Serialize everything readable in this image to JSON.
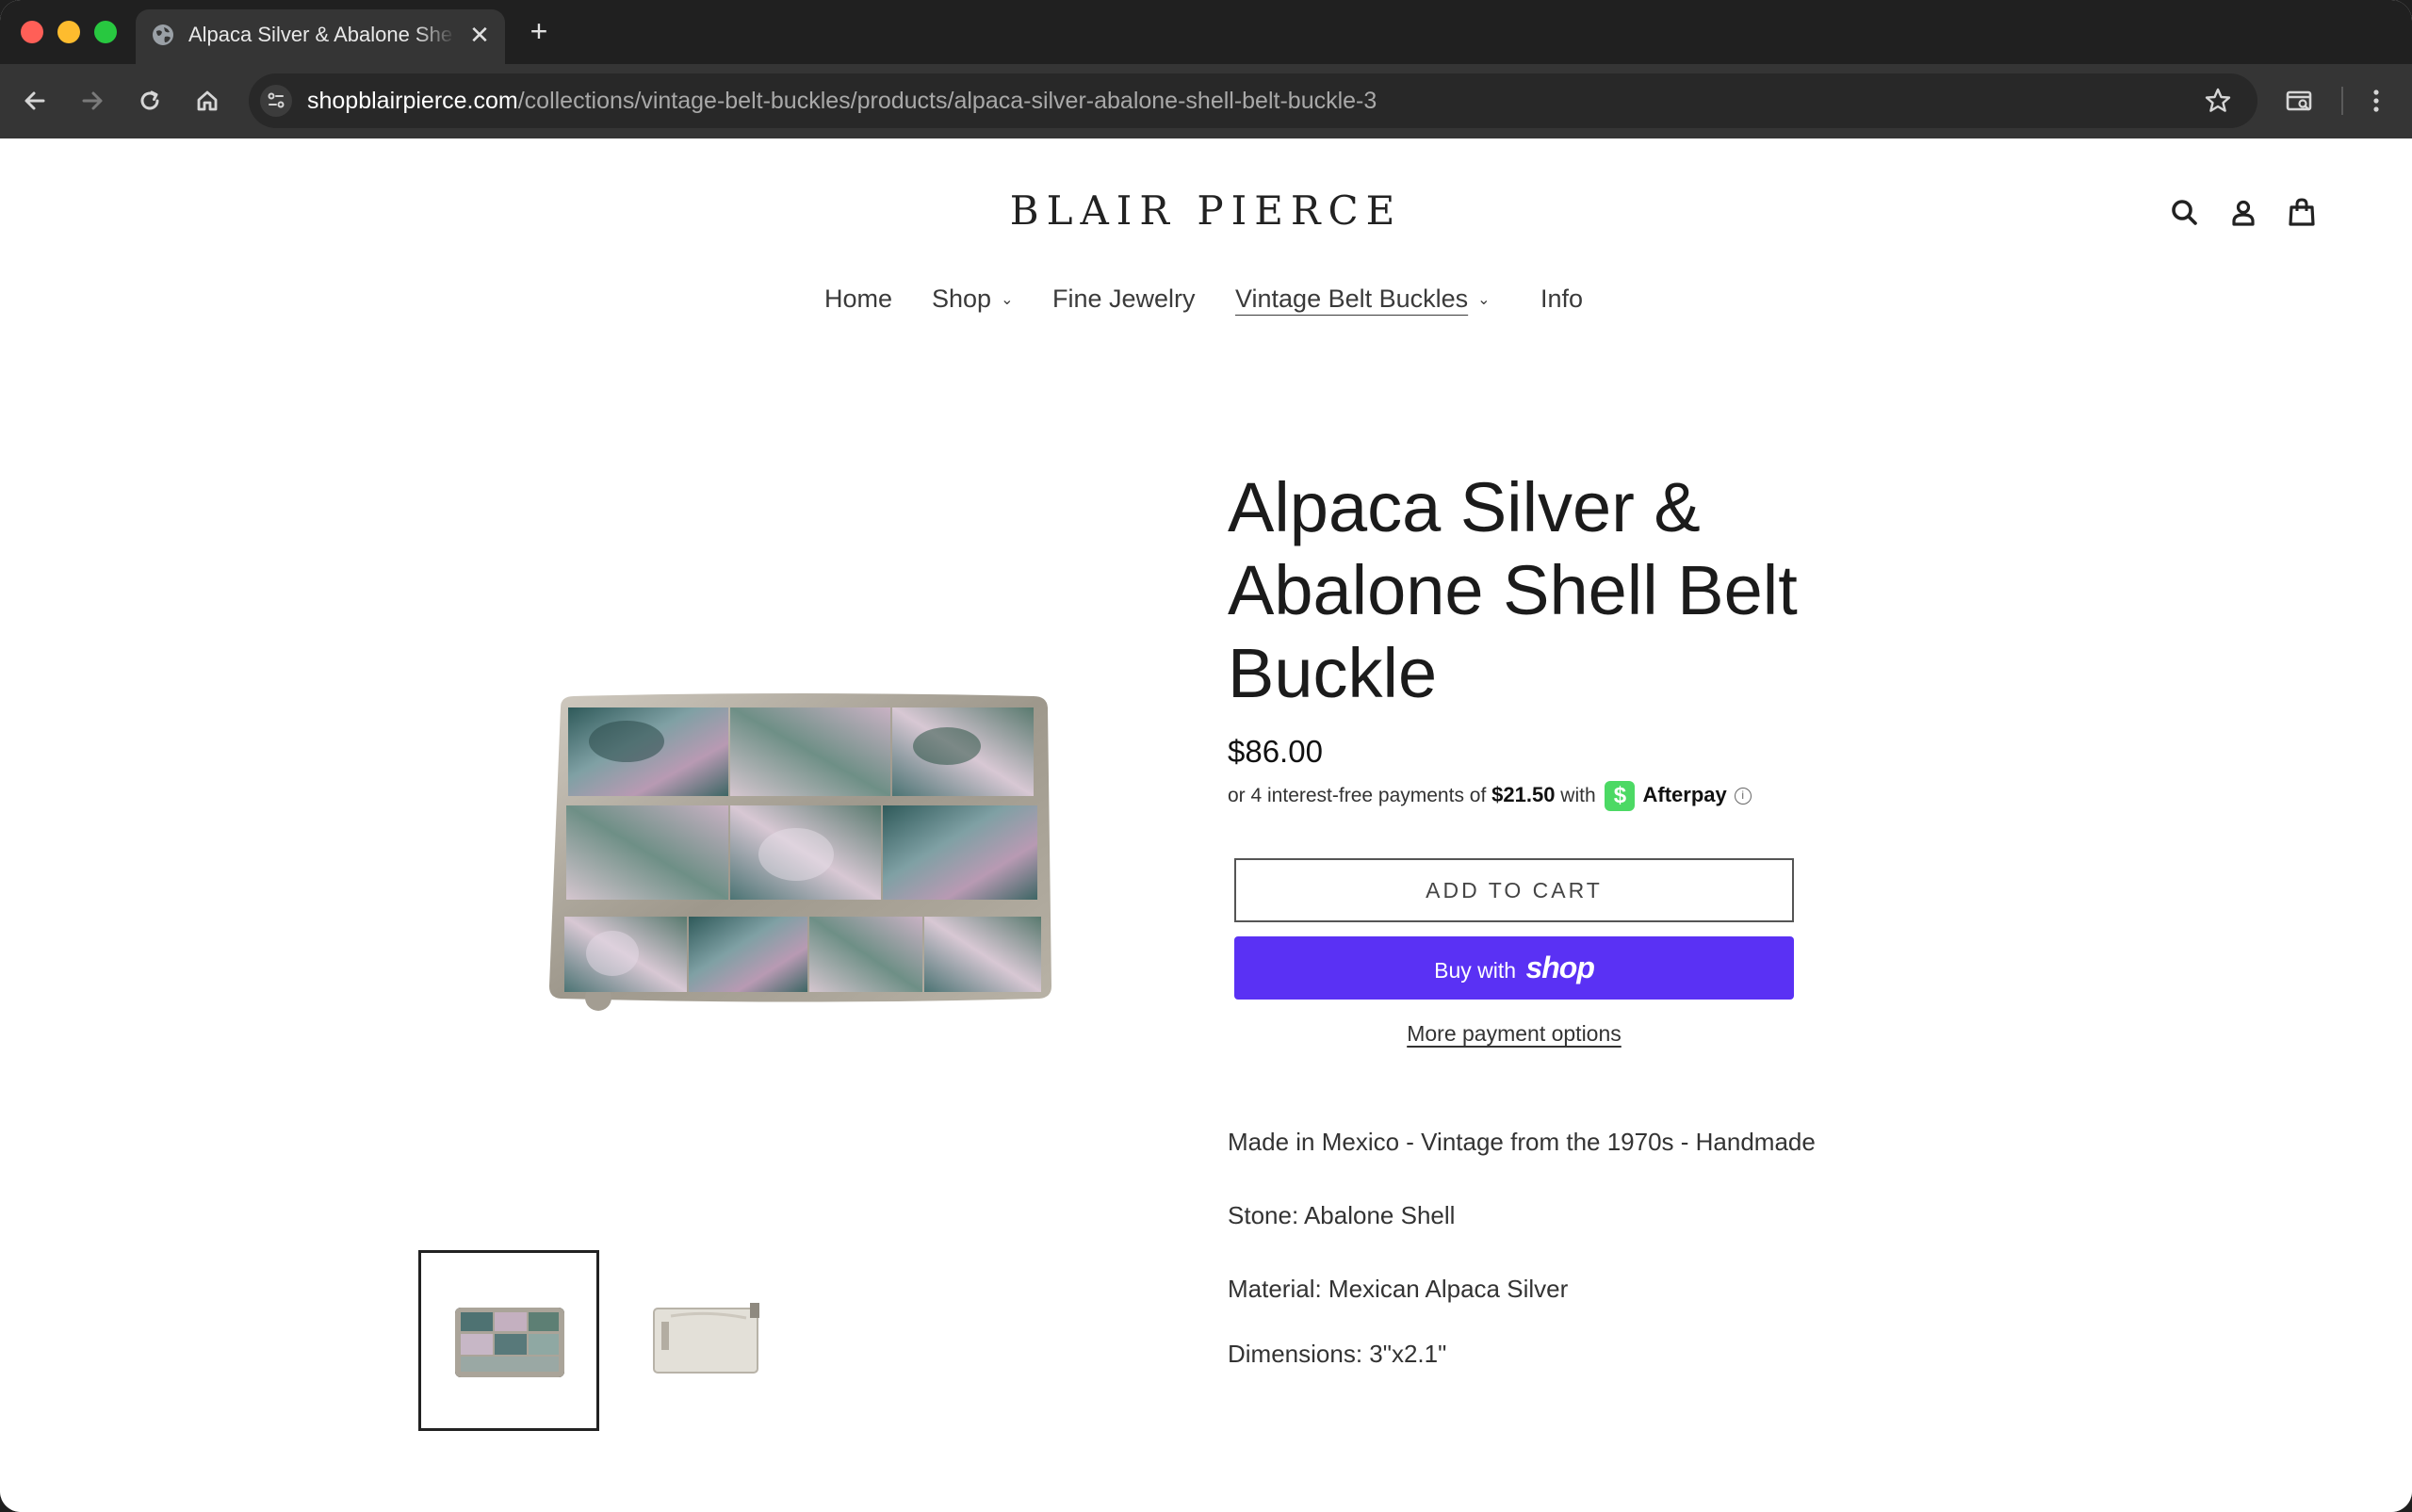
{
  "browser": {
    "tab_title": "Alpaca Silver & Abalone Shell Belt Buckle",
    "tab_close": "✕",
    "new_tab": "+",
    "url_host": "shopblairpierce.com",
    "url_path": "/collections/vintage-belt-buckles/products/alpaca-silver-abalone-shell-belt-buckle-3",
    "colors": {
      "chrome_bg": "#202020",
      "toolbar_bg": "#353535",
      "omnibox_bg": "#282828"
    }
  },
  "store": {
    "logo": "BLAIR PIERCE",
    "nav": [
      {
        "label": "Home",
        "has_dropdown": false,
        "active": false
      },
      {
        "label": "Shop",
        "has_dropdown": true,
        "active": false
      },
      {
        "label": "Fine Jewelry",
        "has_dropdown": false,
        "active": false
      },
      {
        "label": "Vintage Belt Buckles",
        "has_dropdown": true,
        "active": true
      },
      {
        "label": "Info",
        "has_dropdown": false,
        "active": false
      }
    ],
    "caret": "⌄",
    "header_icons": [
      "search-icon",
      "account-icon",
      "cart-icon"
    ]
  },
  "product": {
    "title": "Alpaca Silver & Abalone Shell Belt Buckle",
    "price": "$86.00",
    "afterpay": {
      "prefix": "or 4 interest-free payments of",
      "amount": "$21.50",
      "with": "with",
      "badge": "$",
      "brand": "Afterpay",
      "info": "i",
      "brand_color": "#4cd964"
    },
    "add_to_cart": "ADD TO CART",
    "buy_with": "Buy with",
    "buy_brand": "shop",
    "buy_color": "#5a31f4",
    "more_payment": "More payment options",
    "description": [
      "Made in Mexico - Vintage from the 1970s - Handmade",
      "Stone: Abalone Shell",
      "Material: Mexican Alpaca Silver",
      "Dimensions: 3\"x2.1\""
    ],
    "thumbnails": [
      "front-view",
      "back-view"
    ]
  }
}
